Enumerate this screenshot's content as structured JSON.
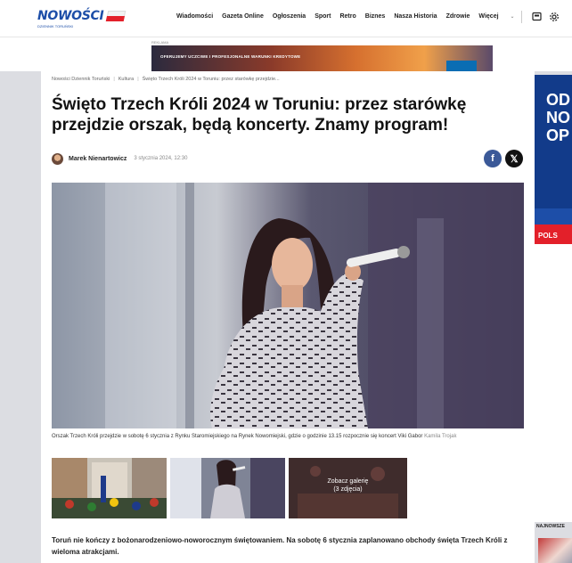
{
  "header": {
    "logo": "NOWOŚCI",
    "logo_sub": "DZIENNIK TORUŃSKI",
    "nav": [
      "Wiadomości",
      "Gazeta Online",
      "Ogłoszenia",
      "Sport",
      "Retro",
      "Biznes",
      "Nasza Historia",
      "Zdrowie"
    ],
    "more_label": "Więcej",
    "icons": [
      "newspaper-icon",
      "settings-icon"
    ]
  },
  "ad": {
    "label": "REKLAMA",
    "banner_text": "OFERUJEMY UCZCIWE I PROFESJONALNE WARUNKI KREDYTOWE"
  },
  "breadcrumb": [
    "Nowości Dziennik Toruński",
    "Kultura",
    "Święto Trzech Króli 2024 w Toruniu: przez starówkę przejdzie..."
  ],
  "article": {
    "title": "Święto Trzech Króli 2024 w Toruniu: przez starówkę przejdzie orszak, będą koncerty. Znamy program!",
    "author": "Marek Nienartowicz",
    "date": "3 stycznia 2024, 12:30",
    "caption": "Orszak Trzech Króli przejdzie w sobotę 6 stycznia z Rynku Staromiejskiego na Rynek Nowomiejski, gdzie o godzinie 13.15 rozpocznie się koncert Viki Gabor",
    "credit": "Kamila Trojak",
    "gallery_label": "Zobacz galerię",
    "gallery_count": "(3 zdjęcia)",
    "lead": "Toruń nie kończy z bożonarodzeniowo-noworocznym świętowaniem. Na sobotę 6 stycznia zaplanowano obchody święta Trzech Króli z wieloma atrakcjami."
  },
  "share": {
    "facebook": "f",
    "x": "𝕏"
  },
  "side": {
    "ad_text": "OD\nNO\nOP",
    "ad_bottom": "POLS",
    "section_heading": "NAJNOWSZE"
  }
}
